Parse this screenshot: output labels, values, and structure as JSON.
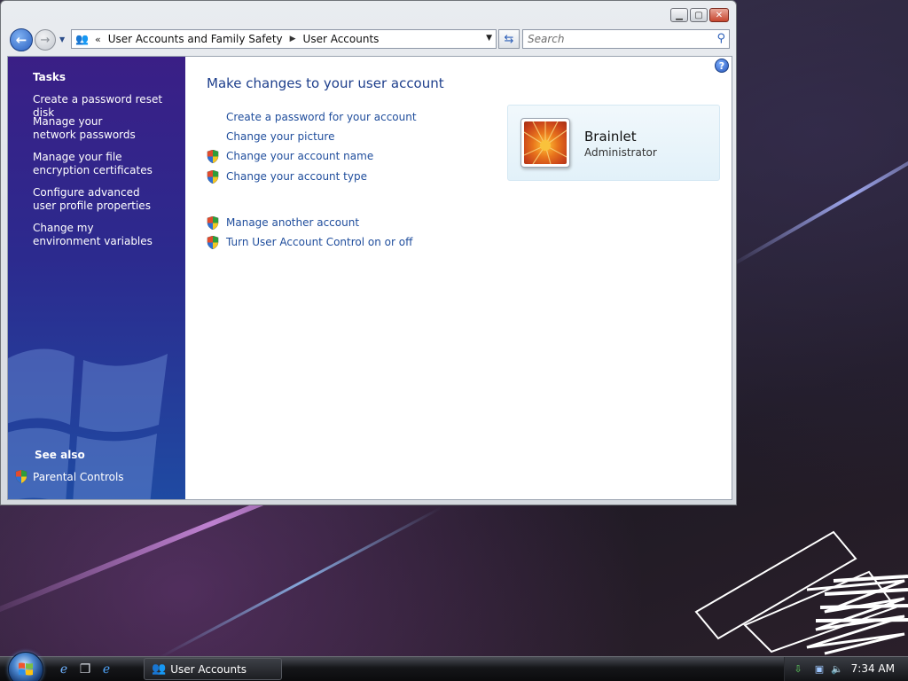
{
  "window": {
    "title_buttons": [
      "minimize",
      "maximize",
      "close"
    ]
  },
  "address_bar": {
    "overflow": "«",
    "breadcrumbs": [
      "User Accounts and Family Safety",
      "User Accounts"
    ],
    "search_placeholder": "Search"
  },
  "sidebar": {
    "tasks_heading": "Tasks",
    "tasks": [
      "Create a password reset disk",
      "Manage your network passwords",
      "Manage your file encryption certificates",
      "Configure advanced user profile properties",
      "Change my environment variables"
    ],
    "see_also_heading": "See also",
    "see_also": [
      "Parental Controls"
    ]
  },
  "main": {
    "title": "Make changes to your user account",
    "links": [
      {
        "label": "Create a password for your account",
        "shield": false
      },
      {
        "label": "Change your picture",
        "shield": false
      },
      {
        "label": "Change your account name",
        "shield": true
      },
      {
        "label": "Change your account type",
        "shield": true
      },
      {
        "label": "Manage another account",
        "shield": true
      },
      {
        "label": "Turn User Account Control on or off",
        "shield": true
      }
    ],
    "user": {
      "name": "Brainlet",
      "role": "Administrator"
    }
  },
  "taskbar": {
    "active_window": "User Accounts",
    "clock": "7:34 AM"
  },
  "colors": {
    "link": "#1f4d9c",
    "title": "#1e3f8c",
    "sidebar_top": "#3a1f86",
    "sidebar_bottom": "#1f4aa2"
  }
}
